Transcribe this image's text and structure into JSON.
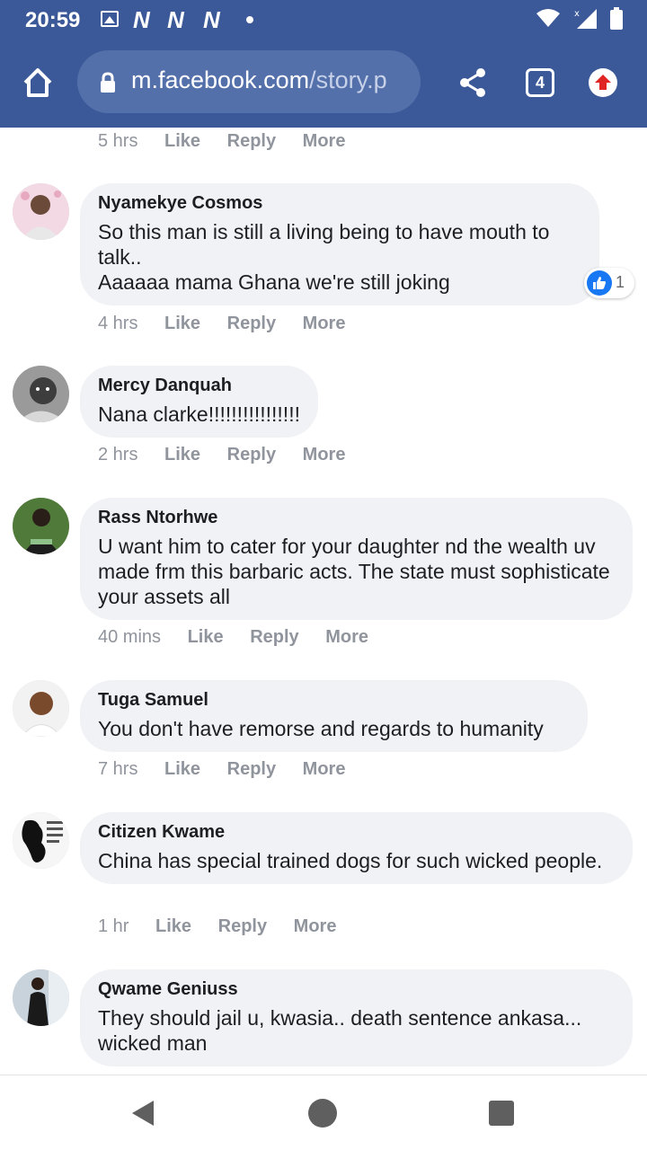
{
  "status_bar": {
    "time": "20:59",
    "notifications": [
      "N",
      "N",
      "N"
    ]
  },
  "browser": {
    "url_domain": "m.facebook.com",
    "url_path": "/story.p",
    "tab_count": "4"
  },
  "top_partial": {
    "time": "5 hrs",
    "like": "Like",
    "reply": "Reply",
    "more": "More"
  },
  "comments": [
    {
      "author": "Nyamekye Cosmos",
      "text": "So this man is still a living being to have mouth to talk..\nAaaaaa mama Ghana we're still joking",
      "time": "4 hrs",
      "like": "Like",
      "reply": "Reply",
      "more": "More",
      "reaction_count": "1"
    },
    {
      "author": "Mercy Danquah",
      "text": "Nana clarke!!!!!!!!!!!!!!!!",
      "time": "2 hrs",
      "like": "Like",
      "reply": "Reply",
      "more": "More"
    },
    {
      "author": "Rass Ntorhwe",
      "text": "U want him to cater for your daughter nd the wealth uv made frm this barbaric acts. The state must sophisticate your assets all",
      "time": "40 mins",
      "like": "Like",
      "reply": "Reply",
      "more": "More"
    },
    {
      "author": "Tuga Samuel",
      "text": "You don't have remorse and regards to humanity",
      "time": "7 hrs",
      "like": "Like",
      "reply": "Reply",
      "more": "More"
    },
    {
      "author": "Citizen Kwame",
      "text": "China has special trained dogs for such wicked people.",
      "time": "1 hr",
      "like": "Like",
      "reply": "Reply",
      "more": "More"
    },
    {
      "author": "Qwame Geniuss",
      "text": "They should jail u, kwasia.. death sentence ankasa... wicked man",
      "time": "",
      "like": "",
      "reply": "",
      "more": ""
    }
  ],
  "colors": {
    "brand_blue": "#3b5998",
    "bubble_bg": "#f0f2f5",
    "meta_gray": "#90949c",
    "like_blue": "#1877f2"
  },
  "icons": {
    "home": "home-icon",
    "lock": "lock-icon",
    "share": "share-icon",
    "tabs": "tabs-icon",
    "upload": "upload-arrow-icon",
    "back": "nav-back-icon",
    "nav_home": "nav-home-icon",
    "recent": "nav-recent-icon"
  }
}
